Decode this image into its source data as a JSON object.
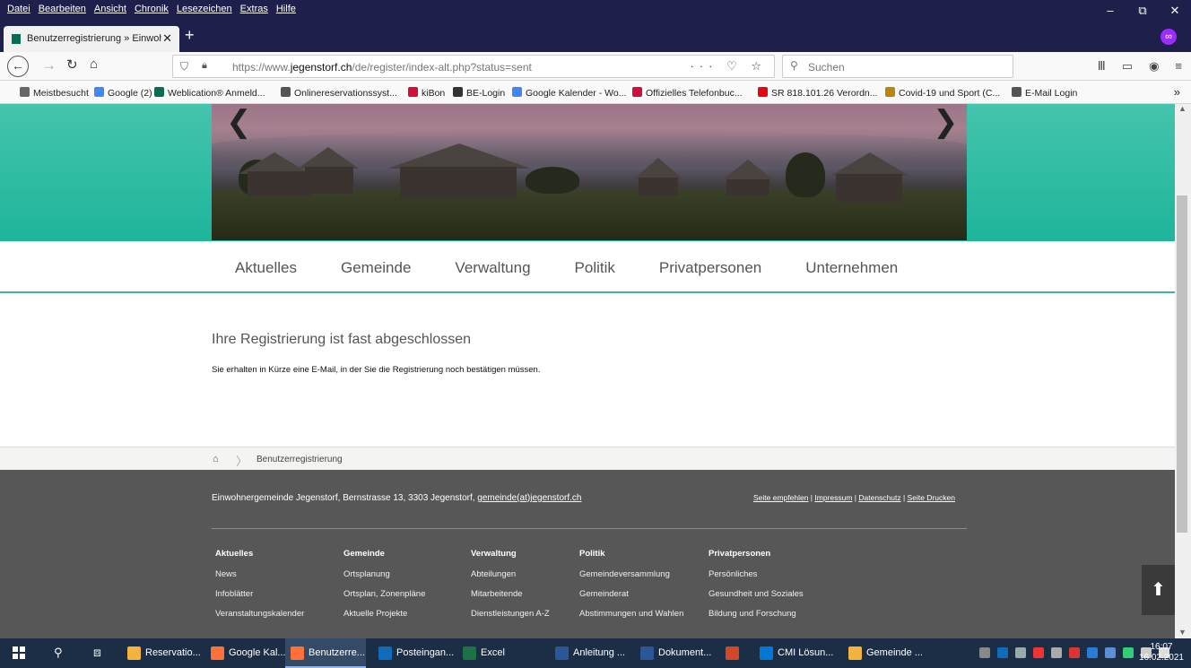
{
  "window": {
    "menu": [
      "Datei",
      "Bearbeiten",
      "Ansicht",
      "Chronik",
      "Lesezeichen",
      "Extras",
      "Hilfe"
    ],
    "controls": [
      "–",
      "⧉",
      "✕"
    ]
  },
  "tab": {
    "title": "Benutzerregistrierung » Einwoh",
    "close": "✕",
    "new": "+",
    "extension_badge": "∞"
  },
  "navbar": {
    "url_prefix": "https://www.",
    "url_host": "jegenstorf.ch",
    "url_path": "/de/register/index-alt.php?status=sent",
    "url_actions": "··· ♡ ☆",
    "search_placeholder": "Suchen"
  },
  "bookmarks": [
    {
      "label": "Meistbesucht",
      "color": "#666666"
    },
    {
      "label": "Google (2)",
      "color": "#4285f4"
    },
    {
      "label": "Weblication® Anmeld...",
      "color": "#0a6b53"
    },
    {
      "label": "Onlinereservationssyst...",
      "color": "#555555"
    },
    {
      "label": "kiBon",
      "color": "#d0103a"
    },
    {
      "label": "BE-Login",
      "color": "#333333"
    },
    {
      "label": "Google Kalender - Wo...",
      "color": "#4285f4"
    },
    {
      "label": "Offizielles Telefonbuc...",
      "color": "#d0103a"
    },
    {
      "label": "SR 818.101.26 Verordn...",
      "color": "#e30613"
    },
    {
      "label": "Covid-19 und Sport (C...",
      "color": "#b8860b"
    },
    {
      "label": "E-Mail Login",
      "color": "#555555"
    }
  ],
  "hero": {
    "prev": "❮",
    "next": "❯"
  },
  "mainnav": [
    "Aktuelles",
    "Gemeinde",
    "Verwaltung",
    "Politik",
    "Privatpersonen",
    "Unternehmen"
  ],
  "content": {
    "heading": "Ihre Registrierung ist fast abgeschlossen",
    "text": "Sie erhalten in Kürze eine E-Mail, in der Sie die Registrierung noch bestätigen müssen."
  },
  "breadcrumb": {
    "home": "⌂",
    "separator": "〉",
    "current": "Benutzerregistrierung"
  },
  "footer": {
    "address": "Einwohnergemeinde Jegenstorf, Bernstrasse 13, 3303 Jegenstorf, ",
    "email": "gemeinde(at)jegenstorf.ch",
    "links": [
      "Seite empfehlen",
      "Impressum",
      "Datenschutz",
      "Seite Drucken"
    ],
    "columns": [
      {
        "heading": "Aktuelles",
        "items": [
          "News",
          "Infoblätter",
          "Veranstaltungskalender"
        ]
      },
      {
        "heading": "Gemeinde",
        "items": [
          "Ortsplanung",
          "Ortsplan, Zonenpläne",
          "Aktuelle Projekte"
        ]
      },
      {
        "heading": "Verwaltung",
        "items": [
          "Abteilungen",
          "Mitarbeitende",
          "Dienstleistungen A-Z"
        ]
      },
      {
        "heading": "Politik",
        "items": [
          "Gemeindeversammlung",
          "Gemeinderat",
          "Abstimmungen und Wahlen"
        ]
      },
      {
        "heading": "Privatpersonen",
        "items": [
          "Persönliches",
          "Gesundheit und Soziales",
          "Bildung und Forschung"
        ]
      }
    ],
    "to_top": "⬆"
  },
  "taskbar": {
    "apps": [
      {
        "label": "Reservatio...",
        "color": "#f2b43c",
        "active": false
      },
      {
        "label": "Google Kal...",
        "color": "#ff7139",
        "active": false
      },
      {
        "label": "Benutzerre...",
        "color": "#ff7139",
        "active": true
      },
      {
        "label": "Posteingan...",
        "color": "#0f6cbd",
        "active": false
      },
      {
        "label": "Excel",
        "color": "#1e7145",
        "active": false
      },
      {
        "label": "Anleitung ...",
        "color": "#2b579a",
        "active": false
      },
      {
        "label": "Dokument...",
        "color": "#2b579a",
        "active": false
      },
      {
        "label": "",
        "color": "#d24726",
        "active": false
      },
      {
        "label": "CMI Lösun...",
        "color": "#0078d4",
        "active": false
      },
      {
        "label": "Gemeinde ...",
        "color": "#f2b43c",
        "active": false
      }
    ],
    "time": "16:07",
    "date": "16.02.2021"
  }
}
